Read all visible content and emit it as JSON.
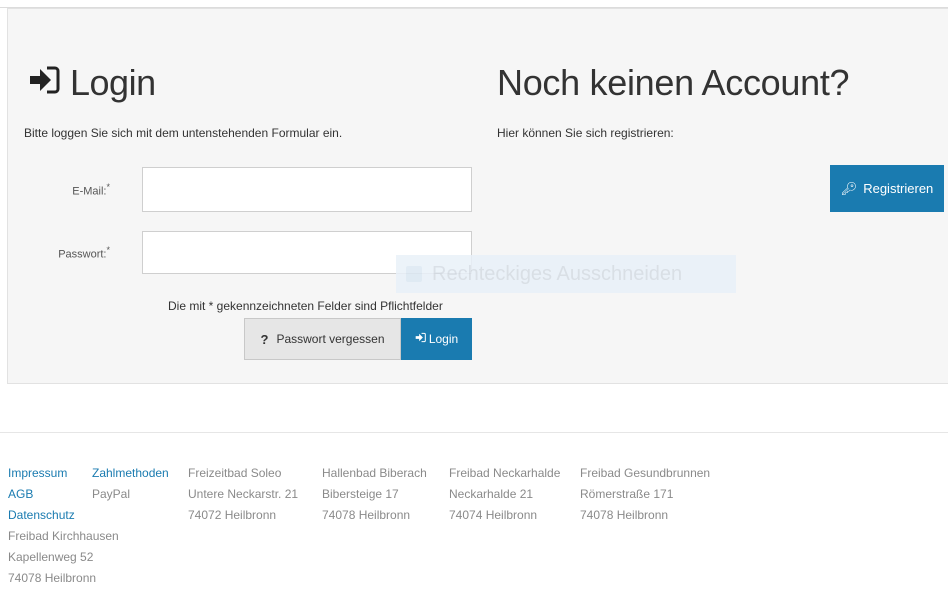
{
  "login": {
    "title": "Login",
    "subtitle": "Bitte loggen Sie sich mit dem untenstehenden Formular ein.",
    "email_label": "E-Mail:",
    "password_label": "Passwort:",
    "required_star": "*",
    "email_value": "",
    "password_value": "",
    "required_note": "Die mit * gekennzeichneten Felder sind Pflichtfelder",
    "forgot_icon": "?",
    "forgot_label": "Passwort vergessen",
    "login_button_label": "Login"
  },
  "register": {
    "title": "Noch keinen Account?",
    "subtitle": "Hier können Sie sich registrieren:",
    "button_label": "Registrieren"
  },
  "overlay": {
    "text": "Rechteckiges Ausschneiden"
  },
  "footer": {
    "links_col1": [
      "Impressum",
      "AGB",
      "Datenschutz"
    ],
    "col1_text": [
      "Freibad Kirchhausen",
      "Kapellenweg 52",
      "74078 Heilbronn"
    ],
    "col2_link": "Zahlmethoden",
    "col2_text": [
      "PayPal"
    ],
    "venues": [
      {
        "name": "Freizeitbad Soleo",
        "street": "Untere Neckarstr. 21",
        "city": "74072 Heilbronn"
      },
      {
        "name": "Hallenbad Biberach",
        "street": "Bibersteige 17",
        "city": "74078 Heilbronn"
      },
      {
        "name": "Freibad Neckarhalde",
        "street": "Neckarhalde 21",
        "city": "74074 Heilbronn"
      },
      {
        "name": "Freibad Gesundbrunnen",
        "street": "Römerstraße 171",
        "city": "74078 Heilbronn"
      }
    ]
  },
  "colors": {
    "accent": "#1a7bb0",
    "panel_bg": "#f6f6f6"
  }
}
